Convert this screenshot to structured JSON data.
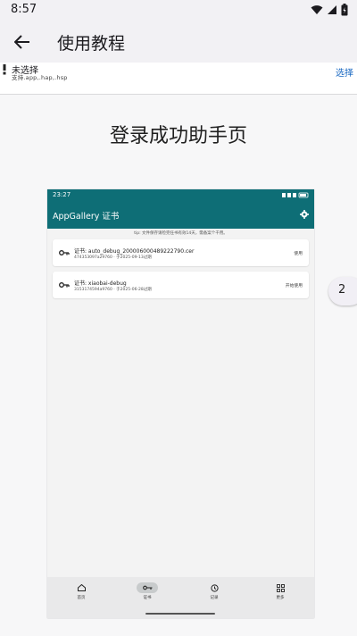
{
  "status_bar": {
    "time": "8:57"
  },
  "app_bar": {
    "title": "使用教程"
  },
  "file_bar": {
    "file_name": "未选择",
    "hint": "支持.app,.hap,.hsp",
    "select_label": "选择"
  },
  "tutorial": {
    "title": "登录成功助手页",
    "page_number": "2"
  },
  "embedded_screen": {
    "status_time": "23:27",
    "app_title": "AppGallery 证书",
    "tip": "tip: 文件保存请检完任书有效14天，需备案个千用。",
    "certificates": [
      {
        "name": "证书: auto_debug_200006000489222790.cer",
        "sub": "474353097a29760 · 于2025-09-13过期",
        "action": "使用"
      },
      {
        "name": "证书: xiaobai-debug",
        "sub": "3153174594a9760 · 于2025-06-28过期",
        "action": "开始使用"
      }
    ],
    "nav": [
      {
        "label": "首页",
        "icon": "home-icon"
      },
      {
        "label": "证书",
        "icon": "key-icon",
        "active": true
      },
      {
        "label": "记录",
        "icon": "history-icon"
      },
      {
        "label": "更多",
        "icon": "apps-icon"
      }
    ]
  }
}
